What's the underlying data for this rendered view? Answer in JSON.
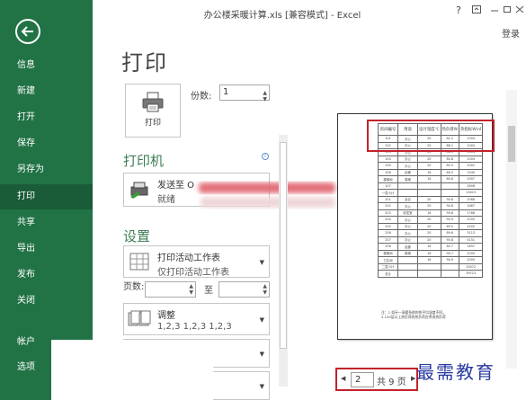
{
  "window": {
    "title": "办公楼采暖计算.xls  [兼容模式] - Excel",
    "help_icon": "?",
    "login": "登录"
  },
  "backstage": {
    "color": "#217346",
    "active_color": "#1a5c38",
    "items": [
      {
        "label": "信息"
      },
      {
        "label": "新建"
      },
      {
        "label": "打开"
      },
      {
        "label": "保存"
      },
      {
        "label": "另存为"
      },
      {
        "label": "打印"
      },
      {
        "label": "共享"
      },
      {
        "label": "导出"
      },
      {
        "label": "发布"
      },
      {
        "label": "关闭"
      },
      {
        "label": "帐户"
      },
      {
        "label": "选项"
      }
    ],
    "active_item": "打印"
  },
  "print": {
    "title": "打印",
    "print_button_label": "打印",
    "copies_label": "份数:",
    "copies_value": "1",
    "printer_heading": "打印机",
    "printer_name": "发送至 O",
    "printer_status": "就绪",
    "settings_heading": "设置",
    "print_what_line1": "打印活动工作表",
    "print_what_line2": "仅打印活动工作表",
    "pages_label": "页数:",
    "pages_to_label": "至",
    "collate_line1": "调整",
    "collate_line2": "1,2,3    1,2,3    1,2,3"
  },
  "preview": {
    "headers": [
      "房间编号",
      "用途",
      "设计温度℃",
      "热负荷W",
      "热指标W/㎡"
    ],
    "rows": [
      [
        "101",
        "办公",
        "20",
        "81.2",
        "1004"
      ],
      [
        "102",
        "办公",
        "20",
        "88.1",
        "1004"
      ],
      [
        "103",
        "办公",
        "20",
        "80.1",
        "1004"
      ],
      [
        "104",
        "办公",
        "20",
        "80.8",
        "1004"
      ],
      [
        "105",
        "办公",
        "20",
        "85.5",
        "2002"
      ],
      [
        "106",
        "走廊",
        "16",
        "80.5",
        "1545"
      ],
      [
        "楼梯间",
        "楼梯",
        "16",
        "80.6",
        "2907"
      ],
      [
        "107",
        "",
        "",
        "",
        "2608"
      ],
      [
        "一层小计",
        "",
        "",
        "",
        "23415"
      ],
      [
        "201",
        "会议",
        "20",
        "90.8",
        "2568"
      ],
      [
        "202",
        "办公",
        "20",
        "90.8",
        "1867"
      ],
      [
        "203",
        "收发室",
        "18",
        "90.8",
        "1766"
      ],
      [
        "204",
        "办公",
        "20",
        "90.9",
        "2205"
      ],
      [
        "205",
        "办公",
        "20",
        "89.5",
        "2402"
      ],
      [
        "206",
        "办公",
        "20",
        "89.6",
        "3113"
      ],
      [
        "207",
        "办公",
        "20",
        "90.8",
        "4151"
      ],
      [
        "208",
        "走廊",
        "16",
        "80.7",
        "1897"
      ],
      [
        "楼梯间",
        "楼梯",
        "16",
        "90.7",
        "2250"
      ],
      [
        "卫生间",
        "",
        "16",
        "90.9",
        "2000"
      ],
      [
        "二层小计",
        "",
        "",
        "",
        "25072"
      ],
      [
        "总计",
        "",
        "",
        "",
        "59723"
      ]
    ],
    "notes": [
      "注：1.如另一采暖系统的热平均温度不同，",
      "2.150层以上热负荷的热负荷应考虑热负荷"
    ],
    "highlight_color": "#c4222a"
  },
  "page_nav": {
    "current": "2",
    "total": "共 9 页"
  },
  "watermark": "最需教育"
}
